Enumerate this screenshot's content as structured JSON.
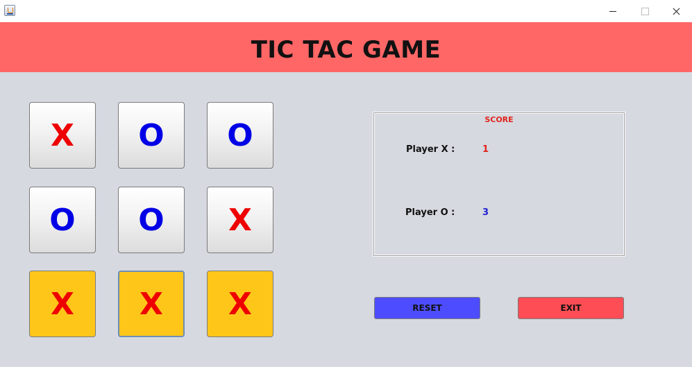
{
  "window": {
    "icon": "java-app-icon"
  },
  "header": {
    "title": "TIC TAC GAME"
  },
  "colors": {
    "header_bg": "#ff6666",
    "content_bg": "#d6d9e0",
    "x_mark": "#ee0000",
    "o_mark": "#0000e6",
    "win_cell": "#ffc61a",
    "score_title": "#e0231b",
    "score_x": "#e0231b",
    "score_o": "#2020d0",
    "reset_btn": "#4d4dff",
    "exit_btn": "#ff4d55"
  },
  "board": {
    "cells": [
      {
        "mark": "X",
        "winning": false
      },
      {
        "mark": "O",
        "winning": false
      },
      {
        "mark": "O",
        "winning": false
      },
      {
        "mark": "O",
        "winning": false
      },
      {
        "mark": "O",
        "winning": false
      },
      {
        "mark": "X",
        "winning": false
      },
      {
        "mark": "X",
        "winning": true
      },
      {
        "mark": "X",
        "winning": true
      },
      {
        "mark": "X",
        "winning": true
      }
    ]
  },
  "score": {
    "title": "SCORE",
    "player_x_label": "Player X :",
    "player_x_value": "1",
    "player_o_label": "Player O :",
    "player_o_value": "3"
  },
  "actions": {
    "reset_label": "RESET",
    "exit_label": "EXIT"
  }
}
